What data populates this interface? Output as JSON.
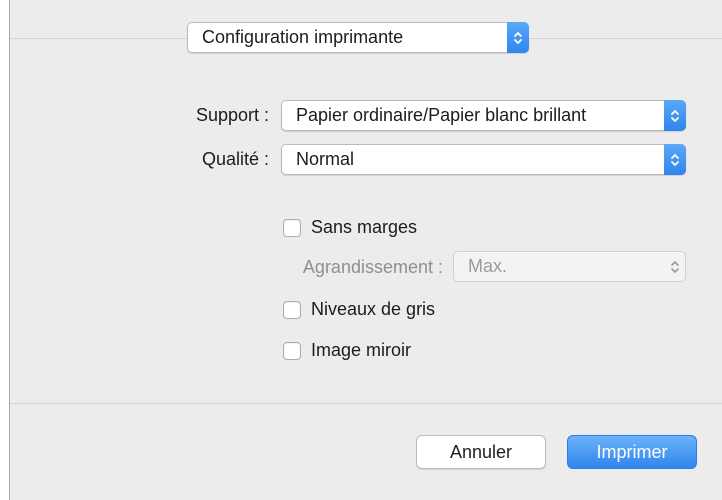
{
  "header": {
    "preset_popup": "Configuration imprimante"
  },
  "form": {
    "support": {
      "label": "Support :",
      "value": "Papier ordinaire/Papier blanc brillant"
    },
    "qualite": {
      "label": "Qualité :",
      "value": "Normal"
    },
    "sans_marges": {
      "label": "Sans marges",
      "checked": false
    },
    "agrandissement": {
      "label": "Agrandissement :",
      "value": "Max.",
      "enabled": false
    },
    "niveaux_de_gris": {
      "label": "Niveaux de gris",
      "checked": false
    },
    "image_miroir": {
      "label": "Image miroir",
      "checked": false
    }
  },
  "footer": {
    "cancel_label": "Annuler",
    "print_label": "Imprimer"
  },
  "colors": {
    "accent": "#2f85ee",
    "dialog_bg": "#ececec"
  },
  "icons": {
    "popup_indicator": "updown-chevron-icon"
  }
}
